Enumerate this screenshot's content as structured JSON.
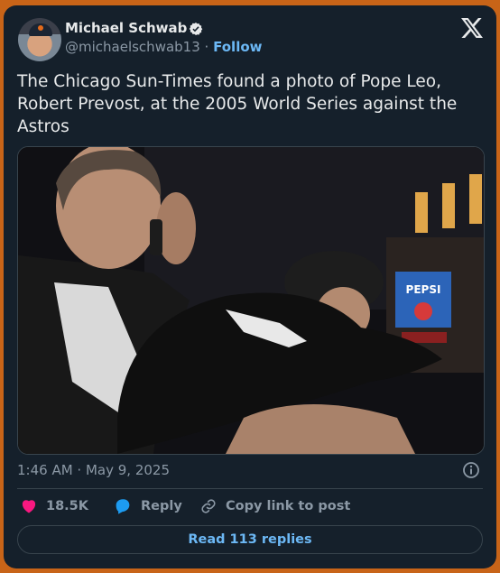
{
  "author": {
    "name": "Michael Schwab",
    "handle": "@michaelschwab13",
    "separator": "·",
    "follow_label": "Follow"
  },
  "tweet": {
    "text": "The Chicago Sun-Times found a photo of Pope Leo, Robert Prevost, at the 2005 World Series against the Astros",
    "photo_sign_text": "PEPSI",
    "timestamp": "1:46 AM · May 9, 2025"
  },
  "actions": {
    "likes_count": "18.5K",
    "reply_label": "Reply",
    "copy_link_label": "Copy link to post"
  },
  "footer": {
    "read_replies_label": "Read 113 replies"
  },
  "icons": {
    "brand": "x-logo-icon",
    "verified": "verified-badge-icon",
    "info": "info-icon",
    "like": "heart-icon",
    "reply": "reply-bubble-icon",
    "copy": "link-icon"
  },
  "colors": {
    "background": "#15202b",
    "accent": "#6cb8f5",
    "like": "#f91880",
    "reply": "#1d9bf0",
    "frame": "#c86418"
  }
}
